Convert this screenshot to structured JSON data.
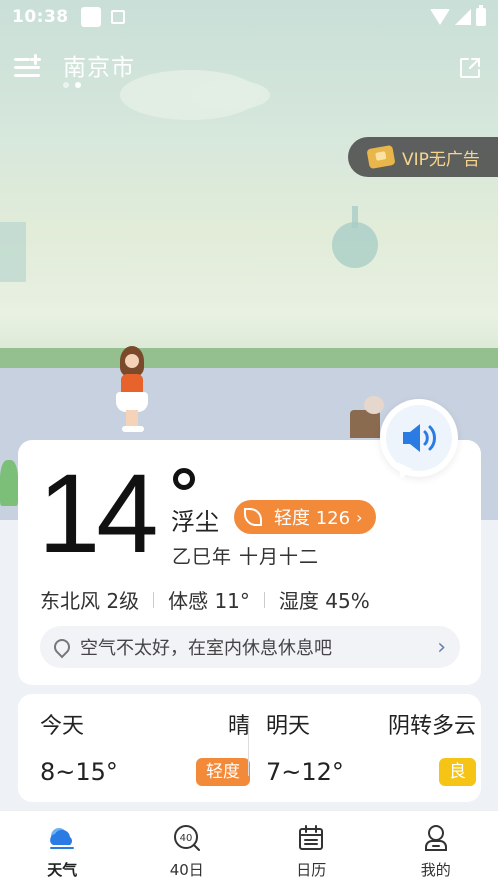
{
  "status_bar": {
    "time": "10:38"
  },
  "header": {
    "city": "南京市",
    "pages": 2,
    "active_page": 2
  },
  "vip": {
    "label": "VIP无广告"
  },
  "current": {
    "temperature": "14",
    "condition": "浮尘",
    "aqi_label": "轻度 126",
    "aqi_color": "#f38a3a",
    "lunar_date": "乙巳年 十月十二",
    "wind": "东北风 2级",
    "feels_like": "体感 11°",
    "humidity": "湿度 45%",
    "advice": "空气不太好，在室内休息休息吧"
  },
  "forecast": [
    {
      "day": "今天",
      "condition": "晴",
      "range": "8~15°",
      "aqi": "轻度",
      "aqi_color": "#f38a3a"
    },
    {
      "day": "明天",
      "condition": "阴转多云",
      "range": "7~12°",
      "aqi": "良",
      "aqi_color": "#f5c414"
    }
  ],
  "nav": [
    {
      "label": "天气",
      "icon": "weather-cloud-icon",
      "active": true
    },
    {
      "label": "40日",
      "icon": "forty-day-icon",
      "active": false
    },
    {
      "label": "日历",
      "icon": "calendar-icon",
      "active": false
    },
    {
      "label": "我的",
      "icon": "profile-icon",
      "active": false
    }
  ],
  "colors": {
    "accent": "#2b7be4",
    "aqi_moderate": "#f38a3a",
    "aqi_good": "#f5c414"
  }
}
